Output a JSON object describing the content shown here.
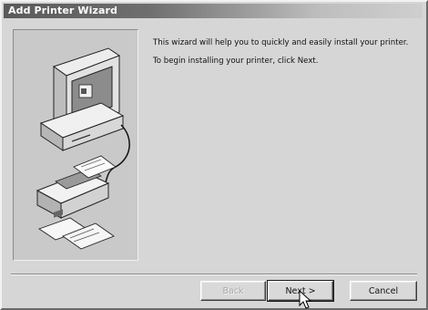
{
  "window": {
    "title": "Add Printer Wizard"
  },
  "message": {
    "line1": "This wizard will help you to quickly and easily install your printer.",
    "line2": "To begin installing your printer, click Next."
  },
  "buttons": {
    "back": "Back",
    "next": "Next >",
    "cancel": "Cancel"
  },
  "icons": {
    "illustration": "printer-and-computer-illustration",
    "cursor": "mouse-pointer-icon"
  }
}
